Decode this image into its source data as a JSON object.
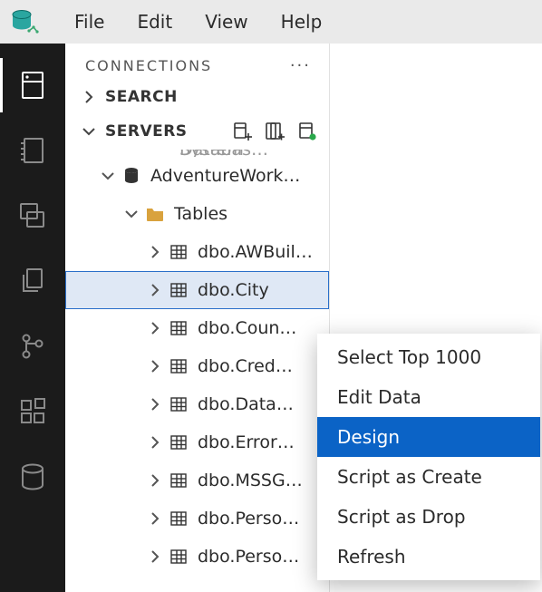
{
  "menubar": {
    "items": [
      "File",
      "Edit",
      "View",
      "Help"
    ]
  },
  "activity_bar": {
    "items": [
      {
        "name": "connections",
        "active": true
      },
      {
        "name": "notebook"
      },
      {
        "name": "windows"
      },
      {
        "name": "copy"
      },
      {
        "name": "source-control"
      },
      {
        "name": "extensions"
      },
      {
        "name": "database"
      }
    ]
  },
  "panel": {
    "title": "CONNECTIONS",
    "more": "···",
    "sections": {
      "search": {
        "label": "SEARCH",
        "expanded": false
      },
      "servers": {
        "label": "SERVERS",
        "expanded": true
      }
    }
  },
  "tree": {
    "truncated_top": "System Databas…",
    "database": {
      "label": "AdventureWork…",
      "expanded": true
    },
    "folder": {
      "label": "Tables",
      "expanded": true
    },
    "tables": [
      "dbo.AWBuil…",
      "dbo.City",
      "dbo.Coun…",
      "dbo.Cred…",
      "dbo.Data…",
      "dbo.Error…",
      "dbo.MSSG…",
      "dbo.Perso…",
      "dbo.Perso…"
    ],
    "selected_index": 1
  },
  "context_menu": {
    "items": [
      "Select Top 1000",
      "Edit Data",
      "Design",
      "Script as Create",
      "Script as Drop",
      "Refresh"
    ],
    "hover_index": 2
  }
}
